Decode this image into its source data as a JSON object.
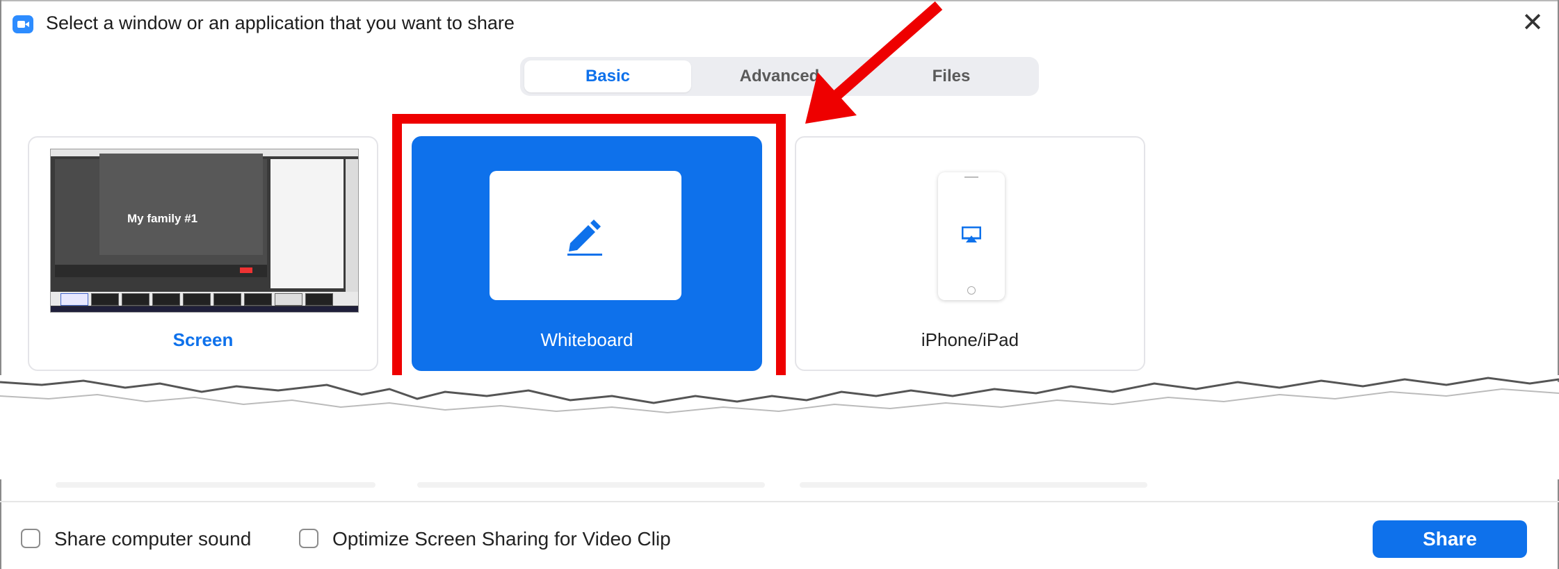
{
  "window": {
    "title": "Select a window or an application that you want to share",
    "close_glyph": "✕"
  },
  "tabs": [
    {
      "label": "Basic",
      "active": true
    },
    {
      "label": "Advanced",
      "active": false
    },
    {
      "label": "Files",
      "active": false
    }
  ],
  "cards": {
    "screen": {
      "label": "Screen",
      "preview_text": "My family #1"
    },
    "whiteboard": {
      "label": "Whiteboard",
      "selected": true
    },
    "iphone": {
      "label": "iPhone/iPad"
    }
  },
  "options": {
    "share_sound": "Share computer sound",
    "optimize_video": "Optimize Screen Sharing for Video Clip"
  },
  "share_button": "Share",
  "colors": {
    "accent": "#0e71eb",
    "annotation_red": "#ee0000"
  },
  "icons": [
    "zoom-app-icon",
    "close-icon",
    "pencil-icon",
    "airplay-icon"
  ]
}
